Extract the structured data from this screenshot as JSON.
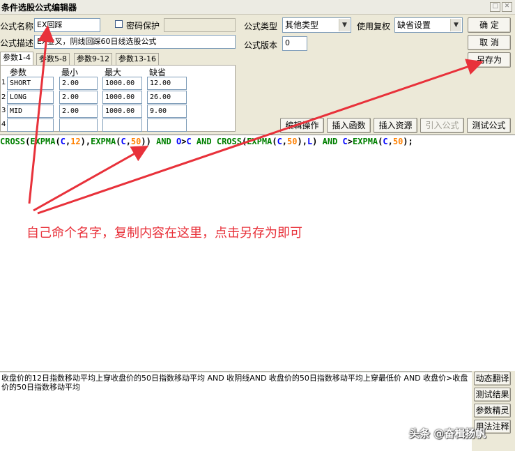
{
  "window": {
    "title": "条件选股公式编辑器",
    "minimize_glyph": "□",
    "close_glyph": "✕"
  },
  "form": {
    "name_label": "公式名称",
    "name_value": "EX回踩",
    "password_label": "密码保护",
    "password_value": "",
    "desc_label": "公式描述",
    "desc_value": "EX金叉，阴线回踩60日线选股公式",
    "type_label": "公式类型",
    "type_value": "其他类型",
    "fq_label": "使用复权",
    "fq_value": "缺省设置",
    "version_label": "公式版本",
    "version_value": "0"
  },
  "buttons": {
    "ok": "确  定",
    "cancel": "取  消",
    "save_as": "另存为",
    "edit_op": "编辑操作",
    "insert_func": "插入函数",
    "insert_res": "插入资源",
    "import_formula": "引入公式",
    "test_formula": "测试公式"
  },
  "tabs": [
    {
      "label": "参数1-4"
    },
    {
      "label": "参数5-8"
    },
    {
      "label": "参数9-12"
    },
    {
      "label": "参数13-16"
    }
  ],
  "params": {
    "headers": {
      "name": "参数",
      "min": "最小",
      "max": "最大",
      "default": "缺省"
    },
    "rows": [
      {
        "num": "1",
        "name": "SHORT",
        "min": "2.00",
        "max": "1000.00",
        "default": "12.00"
      },
      {
        "num": "2",
        "name": "LONG",
        "min": "2.00",
        "max": "1000.00",
        "default": "26.00"
      },
      {
        "num": "3",
        "name": "MID",
        "min": "2.00",
        "max": "1000.00",
        "default": "9.00"
      },
      {
        "num": "4",
        "name": "",
        "min": "",
        "max": "",
        "default": ""
      }
    ]
  },
  "code": {
    "tokens": [
      {
        "t": "CROSS",
        "c": "fn"
      },
      {
        "t": "(",
        "c": "op"
      },
      {
        "t": "EXPMA",
        "c": "fn"
      },
      {
        "t": "(",
        "c": "op"
      },
      {
        "t": "C",
        "c": "var"
      },
      {
        "t": ",",
        "c": "op"
      },
      {
        "t": "12",
        "c": "num"
      },
      {
        "t": "),",
        "c": "op"
      },
      {
        "t": "EXPMA",
        "c": "fn"
      },
      {
        "t": "(",
        "c": "op"
      },
      {
        "t": "C",
        "c": "var"
      },
      {
        "t": ",",
        "c": "op"
      },
      {
        "t": "50",
        "c": "num"
      },
      {
        "t": ")) ",
        "c": "op"
      },
      {
        "t": "AND",
        "c": "kw"
      },
      {
        "t": " ",
        "c": "op"
      },
      {
        "t": "O",
        "c": "var"
      },
      {
        "t": ">",
        "c": "op"
      },
      {
        "t": "C",
        "c": "var"
      },
      {
        "t": " ",
        "c": "op"
      },
      {
        "t": "AND",
        "c": "kw"
      },
      {
        "t": " ",
        "c": "op"
      },
      {
        "t": "CROSS",
        "c": "fn"
      },
      {
        "t": "(",
        "c": "op"
      },
      {
        "t": "EXPMA",
        "c": "fn"
      },
      {
        "t": "(",
        "c": "op"
      },
      {
        "t": "C",
        "c": "var"
      },
      {
        "t": ",",
        "c": "op"
      },
      {
        "t": "50",
        "c": "num"
      },
      {
        "t": "),",
        "c": "op"
      },
      {
        "t": "L",
        "c": "var"
      },
      {
        "t": ") ",
        "c": "op"
      },
      {
        "t": "AND",
        "c": "kw"
      },
      {
        "t": " ",
        "c": "op"
      },
      {
        "t": "C",
        "c": "var"
      },
      {
        "t": ">",
        "c": "op"
      },
      {
        "t": "EXPMA",
        "c": "fn"
      },
      {
        "t": "(",
        "c": "op"
      },
      {
        "t": "C",
        "c": "var"
      },
      {
        "t": ",",
        "c": "op"
      },
      {
        "t": "50",
        "c": "num"
      },
      {
        "t": ");",
        "c": "op"
      }
    ]
  },
  "annotation": "自己命个名字，复制内容在这里，点击另存为即可",
  "description": "收盘价的12日指数移动平均上穿收盘价的50日指数移动平均 AND 收阴线AND 收盘价的50日指数移动平均上穿最低价 AND 收盘价>收盘价的50日指数移动平均",
  "side_buttons": [
    "动态翻译",
    "测试结果",
    "参数精灵",
    "用法注释"
  ],
  "watermark": "头条 @奋楫扬帆",
  "colors": {
    "annotation": "#e8313a",
    "function": "#008000",
    "variable": "#0000ff",
    "number": "#ff8000"
  }
}
